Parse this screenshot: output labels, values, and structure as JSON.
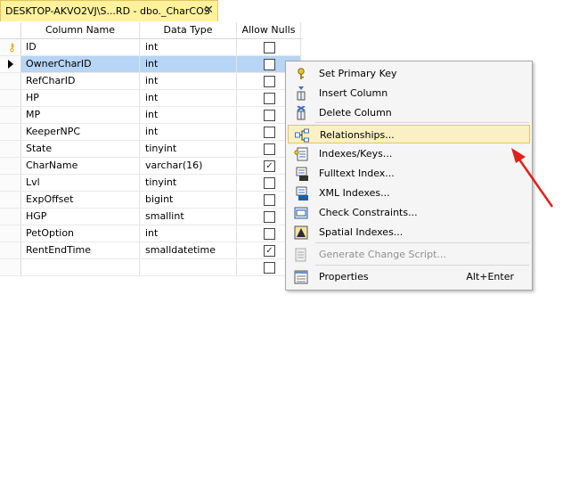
{
  "tab": {
    "title": "DESKTOP-AKVO2VJ\\S...RD - dbo._CharCOS",
    "close": "✕"
  },
  "grid": {
    "headers": {
      "name": "Column Name",
      "type": "Data Type",
      "nulls": "Allow Nulls"
    },
    "rows": [
      {
        "name": "ID",
        "type": "int",
        "allow_nulls": false,
        "primary_key": true,
        "selected": false
      },
      {
        "name": "OwnerCharID",
        "type": "int",
        "allow_nulls": false,
        "primary_key": false,
        "selected": true
      },
      {
        "name": "RefCharID",
        "type": "int",
        "allow_nulls": false,
        "primary_key": false,
        "selected": false
      },
      {
        "name": "HP",
        "type": "int",
        "allow_nulls": false,
        "primary_key": false,
        "selected": false
      },
      {
        "name": "MP",
        "type": "int",
        "allow_nulls": false,
        "primary_key": false,
        "selected": false
      },
      {
        "name": "KeeperNPC",
        "type": "int",
        "allow_nulls": false,
        "primary_key": false,
        "selected": false
      },
      {
        "name": "State",
        "type": "tinyint",
        "allow_nulls": false,
        "primary_key": false,
        "selected": false
      },
      {
        "name": "CharName",
        "type": "varchar(16)",
        "allow_nulls": true,
        "primary_key": false,
        "selected": false
      },
      {
        "name": "Lvl",
        "type": "tinyint",
        "allow_nulls": false,
        "primary_key": false,
        "selected": false
      },
      {
        "name": "ExpOffset",
        "type": "bigint",
        "allow_nulls": false,
        "primary_key": false,
        "selected": false
      },
      {
        "name": "HGP",
        "type": "smallint",
        "allow_nulls": false,
        "primary_key": false,
        "selected": false
      },
      {
        "name": "PetOption",
        "type": "int",
        "allow_nulls": false,
        "primary_key": false,
        "selected": false
      },
      {
        "name": "RentEndTime",
        "type": "smalldatetime",
        "allow_nulls": true,
        "primary_key": false,
        "selected": false
      },
      {
        "name": "",
        "type": "",
        "allow_nulls": false,
        "primary_key": false,
        "selected": false
      }
    ]
  },
  "context_menu": {
    "items": [
      {
        "label": "Set Primary Key",
        "icon": "key-icon"
      },
      {
        "label": "Insert Column",
        "icon": "insert-column-icon"
      },
      {
        "label": "Delete Column",
        "icon": "delete-column-icon"
      },
      {
        "label": "Relationships...",
        "icon": "relationships-icon",
        "highlighted": true
      },
      {
        "label": "Indexes/Keys...",
        "icon": "indexes-keys-icon"
      },
      {
        "label": "Fulltext Index...",
        "icon": "fulltext-index-icon"
      },
      {
        "label": "XML Indexes...",
        "icon": "xml-indexes-icon"
      },
      {
        "label": "Check Constraints...",
        "icon": "check-constraints-icon"
      },
      {
        "label": "Spatial Indexes...",
        "icon": "spatial-indexes-icon"
      },
      {
        "label": "Generate Change Script...",
        "icon": "generate-script-icon",
        "disabled": true
      },
      {
        "label": "Properties",
        "icon": "properties-icon",
        "shortcut": "Alt+Enter"
      }
    ]
  },
  "annotation": {
    "arrow_color": "#e0201b"
  },
  "colors": {
    "tab_active": "#fff29d",
    "row_selected": "#b7d5f5",
    "menu_highlight": "#fbf0c4"
  }
}
